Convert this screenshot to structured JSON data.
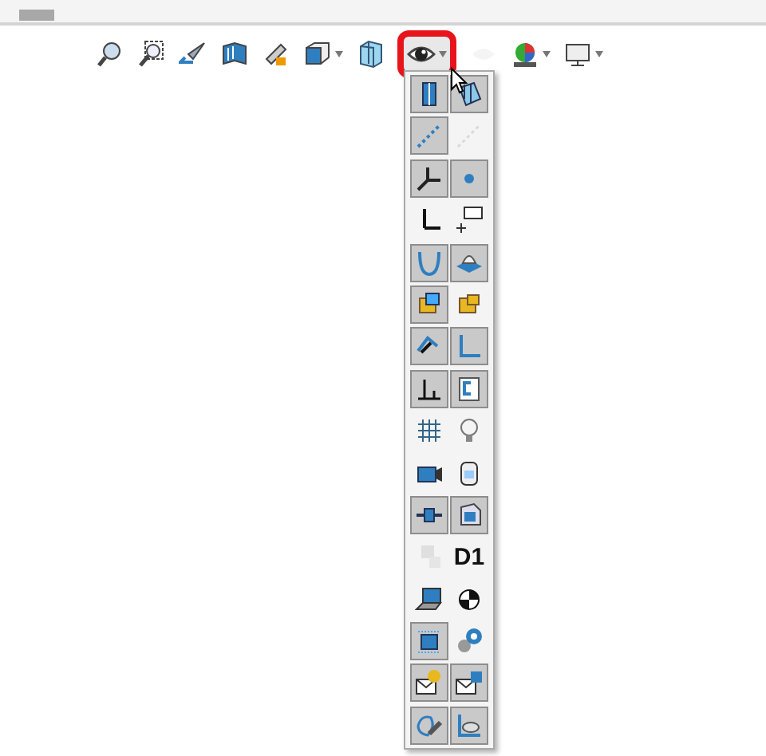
{
  "toolbar": {
    "items": [
      {
        "has_menu": false,
        "disabled": false,
        "highlighted": false
      },
      {
        "has_menu": false,
        "disabled": false,
        "highlighted": false
      },
      {
        "has_menu": false,
        "disabled": false,
        "highlighted": false
      },
      {
        "has_menu": false,
        "disabled": false,
        "highlighted": false
      },
      {
        "has_menu": false,
        "disabled": false,
        "highlighted": false
      },
      {
        "has_menu": true,
        "disabled": false,
        "highlighted": false
      },
      {
        "has_menu": false,
        "disabled": false,
        "highlighted": false
      },
      {
        "has_menu": true,
        "disabled": false,
        "highlighted": true
      },
      {
        "has_menu": false,
        "disabled": true,
        "highlighted": false
      },
      {
        "has_menu": true,
        "disabled": false,
        "highlighted": false
      },
      {
        "has_menu": true,
        "disabled": false,
        "highlighted": false
      }
    ]
  },
  "menu": {
    "items": [
      {
        "kind": "icon",
        "on": true,
        "disabled": false
      },
      {
        "kind": "icon",
        "on": true,
        "disabled": false
      },
      {
        "kind": "icon",
        "on": true,
        "disabled": false
      },
      {
        "kind": "icon",
        "on": false,
        "disabled": true
      },
      {
        "kind": "icon",
        "on": true,
        "disabled": false
      },
      {
        "kind": "icon",
        "on": true,
        "disabled": false
      },
      {
        "kind": "icon",
        "on": false,
        "disabled": false
      },
      {
        "kind": "icon",
        "on": false,
        "disabled": false
      },
      {
        "kind": "icon",
        "on": true,
        "disabled": false
      },
      {
        "kind": "icon",
        "on": true,
        "disabled": false
      },
      {
        "kind": "icon",
        "on": true,
        "disabled": false
      },
      {
        "kind": "icon",
        "on": false,
        "disabled": false
      },
      {
        "kind": "icon",
        "on": true,
        "disabled": false
      },
      {
        "kind": "icon",
        "on": true,
        "disabled": false
      },
      {
        "kind": "icon",
        "on": true,
        "disabled": false
      },
      {
        "kind": "icon",
        "on": true,
        "disabled": false
      },
      {
        "kind": "icon",
        "on": false,
        "disabled": false
      },
      {
        "kind": "icon",
        "on": false,
        "disabled": false
      },
      {
        "kind": "icon",
        "on": false,
        "disabled": false
      },
      {
        "kind": "icon",
        "on": false,
        "disabled": false
      },
      {
        "kind": "icon",
        "on": true,
        "disabled": false
      },
      {
        "kind": "icon",
        "on": true,
        "disabled": false
      },
      {
        "kind": "icon",
        "on": false,
        "disabled": true
      },
      {
        "kind": "text",
        "label": "D1",
        "on": false,
        "disabled": false
      },
      {
        "kind": "icon",
        "on": false,
        "disabled": false
      },
      {
        "kind": "icon",
        "on": false,
        "disabled": false
      },
      {
        "kind": "icon",
        "on": true,
        "disabled": false
      },
      {
        "kind": "icon",
        "on": false,
        "disabled": false
      },
      {
        "kind": "icon",
        "on": true,
        "disabled": false
      },
      {
        "kind": "icon",
        "on": true,
        "disabled": false
      },
      {
        "kind": "icon",
        "on": true,
        "disabled": false
      },
      {
        "kind": "icon",
        "on": true,
        "disabled": false
      }
    ]
  }
}
